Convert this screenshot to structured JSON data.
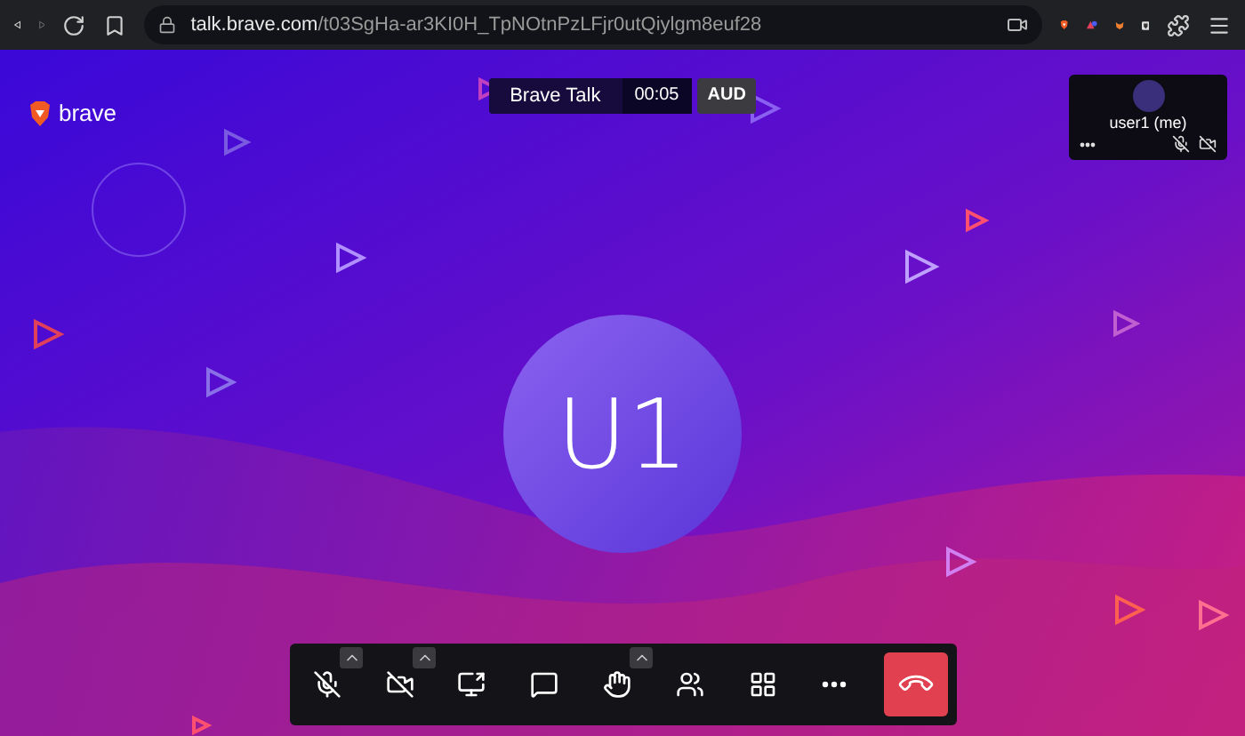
{
  "browser": {
    "url_host": "talk.brave.com",
    "url_path": "/t03SgHa-ar3KI0H_TpNOtnPzLFjr0utQiylgm8euf28"
  },
  "header": {
    "logo": "brave",
    "title": "Brave Talk",
    "timer": "00:05",
    "badge": "AUD"
  },
  "self_view": {
    "label": "user1 (me)",
    "muted": true,
    "camera_off": true
  },
  "avatar": {
    "initials": "U1"
  },
  "toolbar": [
    {
      "kind": "mic",
      "off": true,
      "menu": true
    },
    {
      "kind": "camera",
      "off": true,
      "menu": true
    },
    {
      "kind": "share",
      "menu": false
    },
    {
      "kind": "chat",
      "menu": false
    },
    {
      "kind": "hand",
      "menu": true
    },
    {
      "kind": "participants",
      "menu": false
    },
    {
      "kind": "tiles",
      "menu": false
    },
    {
      "kind": "more",
      "menu": false
    },
    {
      "kind": "hangup",
      "menu": false
    }
  ]
}
